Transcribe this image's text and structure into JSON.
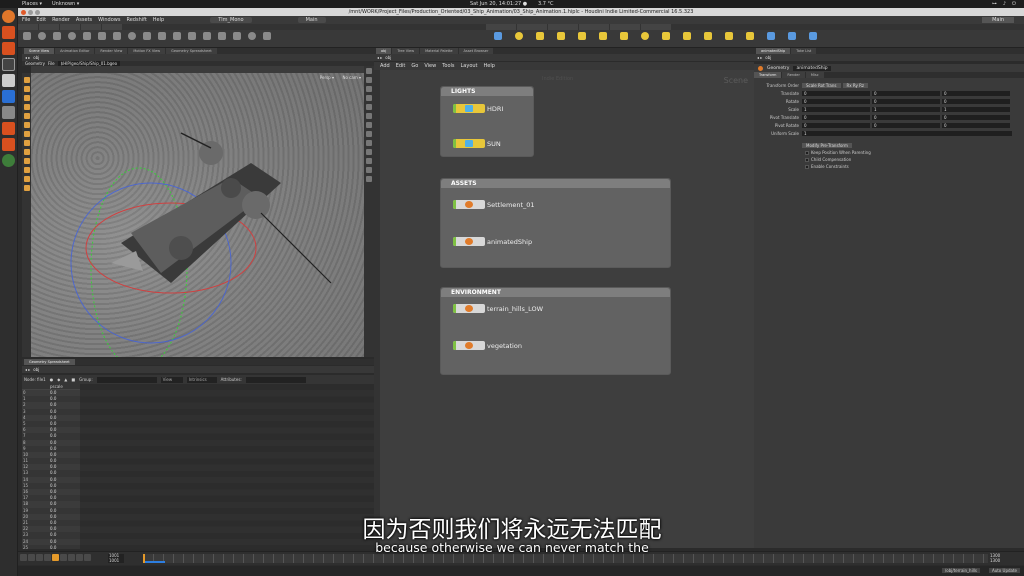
{
  "system_bar": {
    "places": "Places ▾",
    "app": "Unknown ▾",
    "datetime": "Sat Jun 20, 14:01:27 ●",
    "temperature": "3.7 °C"
  },
  "window": {
    "title": "/mnt/WORK/Project_Files/Production_Oriented/03_Ship_Animation/03_Ship_Animation.1.hiplc - Houdini Indie Limited-Commercial 16.5.323"
  },
  "main_menu": {
    "items": [
      "File",
      "Edit",
      "Render",
      "Assets",
      "Windows",
      "Redshift",
      "Help"
    ],
    "shelf_set": "Tlm_Mono",
    "desktop_tab": "Main",
    "desktop_right": "Main"
  },
  "viewport": {
    "pane_tabs": [
      "Scene View",
      "Animation Editor",
      "Render View",
      "Motion FX View",
      "Geometry Spreadsheet"
    ],
    "path": "obj",
    "header": "Geometry",
    "file_label": "File",
    "file_path": "$HIP/geo/Ship/Ship_01.bgeo",
    "label_persp": "Persp ▾",
    "label_cam": "No cam ▾"
  },
  "spreadsheet": {
    "pane_tabs": [
      "Geometry Spreadsheet"
    ],
    "path": "obj",
    "node_label": "Node: file1",
    "group_label": "Group:",
    "view_label": "View",
    "intrinsics_label": "Intrinsics",
    "attributes_label": "Attributes:",
    "columns": [
      "",
      "pscale"
    ],
    "rows": [
      [
        "0",
        "0.0"
      ],
      [
        "1",
        "0.0"
      ],
      [
        "2",
        "0.0"
      ],
      [
        "3",
        "0.0"
      ],
      [
        "4",
        "0.0"
      ],
      [
        "5",
        "0.0"
      ],
      [
        "6",
        "0.0"
      ],
      [
        "7",
        "0.0"
      ],
      [
        "8",
        "0.0"
      ],
      [
        "9",
        "0.0"
      ],
      [
        "10",
        "0.0"
      ],
      [
        "11",
        "0.0"
      ],
      [
        "12",
        "0.0"
      ],
      [
        "13",
        "0.0"
      ],
      [
        "14",
        "0.0"
      ],
      [
        "15",
        "0.0"
      ],
      [
        "16",
        "0.0"
      ],
      [
        "17",
        "0.0"
      ],
      [
        "18",
        "0.0"
      ],
      [
        "19",
        "0.0"
      ],
      [
        "20",
        "0.0"
      ],
      [
        "21",
        "0.0"
      ],
      [
        "22",
        "0.0"
      ],
      [
        "23",
        "0.0"
      ],
      [
        "24",
        "0.0"
      ],
      [
        "25",
        "0.0"
      ]
    ]
  },
  "network": {
    "pane_tabs": [
      "obj",
      "Tree View",
      "Material Palette",
      "Asset Browser"
    ],
    "path": "obj",
    "menu": [
      "Add",
      "Edit",
      "Go",
      "View",
      "Tools",
      "Layout",
      "Help"
    ],
    "watermark": "Scene",
    "title_hint": "Indie Edition",
    "boxes": [
      {
        "title": "LIGHTS",
        "nodes": [
          {
            "label": "HDRI",
            "kind": "light"
          },
          {
            "label": "SUN",
            "kind": "light"
          }
        ]
      },
      {
        "title": "ASSETS",
        "nodes": [
          {
            "label": "Settlement_01",
            "kind": "geo"
          },
          {
            "label": "animatedShip",
            "kind": "geo"
          }
        ]
      },
      {
        "title": "ENVIRONMENT",
        "nodes": [
          {
            "label": "terrain_hills_LOW",
            "kind": "geo"
          },
          {
            "label": "vegetation",
            "kind": "geo"
          }
        ]
      }
    ]
  },
  "parameters": {
    "pane_tabs": [
      "animatedShip",
      "Take List"
    ],
    "path": "obj",
    "node_type": "Geometry",
    "node_name": "animatedShip",
    "subtabs": [
      "Transform",
      "Render",
      "Misc"
    ],
    "transform_order_label": "Transform Order",
    "transform_order_value": "Scale Rot Trans",
    "rotate_order_value": "Rx Ry Rz",
    "rows": [
      {
        "label": "Translate",
        "values": [
          "0",
          "0",
          "0"
        ]
      },
      {
        "label": "Rotate",
        "values": [
          "0",
          "0",
          "0"
        ]
      },
      {
        "label": "Scale",
        "values": [
          "1",
          "1",
          "1"
        ]
      },
      {
        "label": "Pivot Translate",
        "values": [
          "0",
          "0",
          "0"
        ]
      },
      {
        "label": "Pivot Rotate",
        "values": [
          "0",
          "0",
          "0"
        ]
      },
      {
        "label": "Uniform Scale",
        "values": [
          "1"
        ]
      }
    ],
    "modify_button": "Modify Pre-Transform",
    "checks": [
      "Keep Position When Parenting",
      "Child Compensation",
      "Enable Constraints"
    ]
  },
  "timeline": {
    "current_frame": "1001",
    "start_frame": "1001",
    "end_frame": "1300",
    "end_frame_2": "1300",
    "playhead_fraction": 0.0
  },
  "status": {
    "node_path": "/obj/terrain_hills",
    "update_mode": "Auto Update"
  },
  "subtitles": {
    "zh": "因为否则我们将永远无法匹配",
    "en": "because otherwise we can never match the"
  }
}
